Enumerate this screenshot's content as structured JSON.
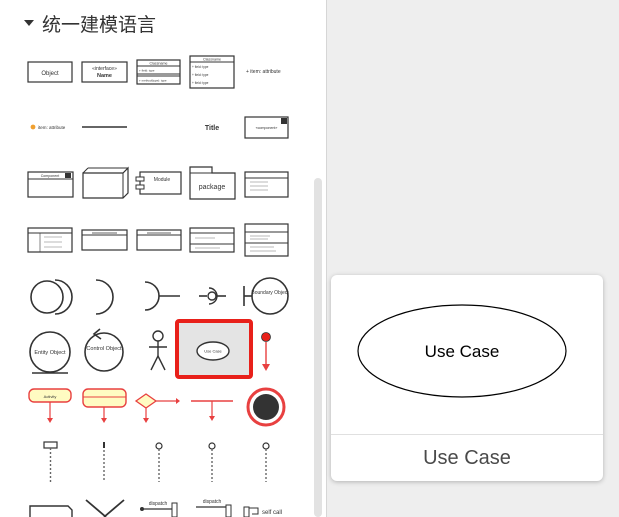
{
  "panel": {
    "section_title": "统一建模语言",
    "expand_icon": "triangle-down-icon"
  },
  "shapes": {
    "object": "Object",
    "interface": "«interface»",
    "interface_name": "Name",
    "classname": "Classname",
    "classname_attr": "+ field: type",
    "classname_method": "+ method(type): type",
    "classname_field1": "+ field: type",
    "classname_field2": "+ field: type",
    "classname_field3": "+ field: type",
    "item_attribute": "+ item: attribute",
    "item_attribute2": "item: attribute",
    "title": "Title",
    "component": "«component»",
    "component2": "Component",
    "module": "Module",
    "package": "package",
    "boundary_object": "Boundary Object",
    "entity_object": "Entity Object",
    "control_object": "Control Object",
    "use_case_small": "Use Case",
    "activity": "Activity",
    "dispatch1": "dispatch",
    "dispatch2": "dispatch",
    "self_call": "self call"
  },
  "preview": {
    "shape_label": "Use Case",
    "caption": "Use Case"
  },
  "colors": {
    "selection": "#e8201a",
    "activity_fill": "#fffbc2",
    "activity_stroke": "#e84040"
  }
}
